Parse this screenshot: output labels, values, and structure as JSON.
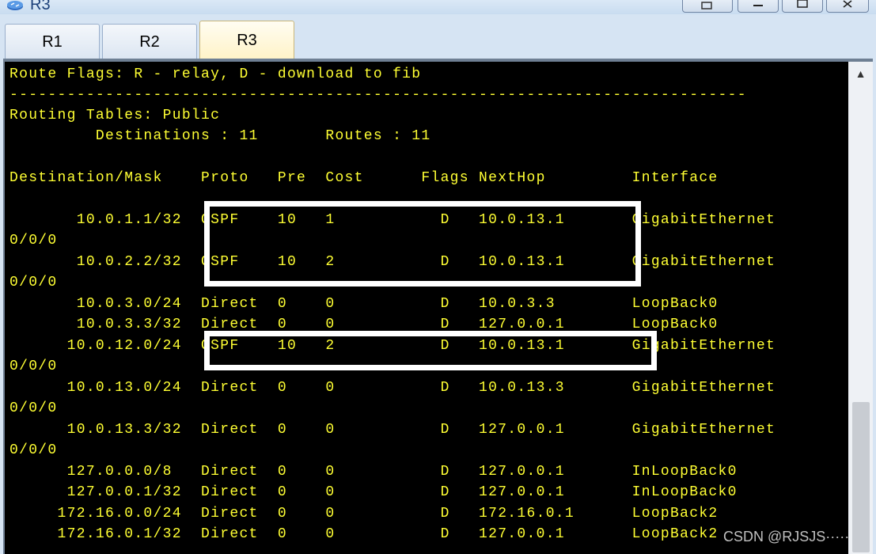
{
  "window": {
    "title": "R3"
  },
  "tabs": [
    {
      "label": "R1"
    },
    {
      "label": "R2"
    },
    {
      "label": "R3"
    }
  ],
  "terminal": {
    "text_color": "#ffff33",
    "lines": [
      "Route Flags: R - relay, D - download to fib",
      "-----------------------------------------------------------------------------",
      "Routing Tables: Public",
      "         Destinations : 11       Routes : 11",
      "",
      "Destination/Mask    Proto   Pre  Cost      Flags NextHop         Interface",
      "",
      "       10.0.1.1/32  OSPF    10   1           D   10.0.13.1       GigabitEthernet",
      "0/0/0",
      "       10.0.2.2/32  OSPF    10   2           D   10.0.13.1       GigabitEthernet",
      "0/0/0",
      "       10.0.3.0/24  Direct  0    0           D   10.0.3.3        LoopBack0",
      "       10.0.3.3/32  Direct  0    0           D   127.0.0.1       LoopBack0",
      "      10.0.12.0/24  OSPF    10   2           D   10.0.13.1       GigabitEthernet",
      "0/0/0",
      "      10.0.13.0/24  Direct  0    0           D   10.0.13.3       GigabitEthernet",
      "0/0/0",
      "      10.0.13.3/32  Direct  0    0           D   127.0.0.1       GigabitEthernet",
      "0/0/0",
      "      127.0.0.0/8   Direct  0    0           D   127.0.0.1       InLoopBack0",
      "      127.0.0.1/32  Direct  0    0           D   127.0.0.1       InLoopBack0",
      "     172.16.0.0/24  Direct  0    0           D   172.16.0.1      LoopBack2",
      "     172.16.0.1/32  Direct  0    0           D   127.0.0.1       LoopBack2"
    ]
  },
  "watermark": "CSDN @RJSJS·····"
}
